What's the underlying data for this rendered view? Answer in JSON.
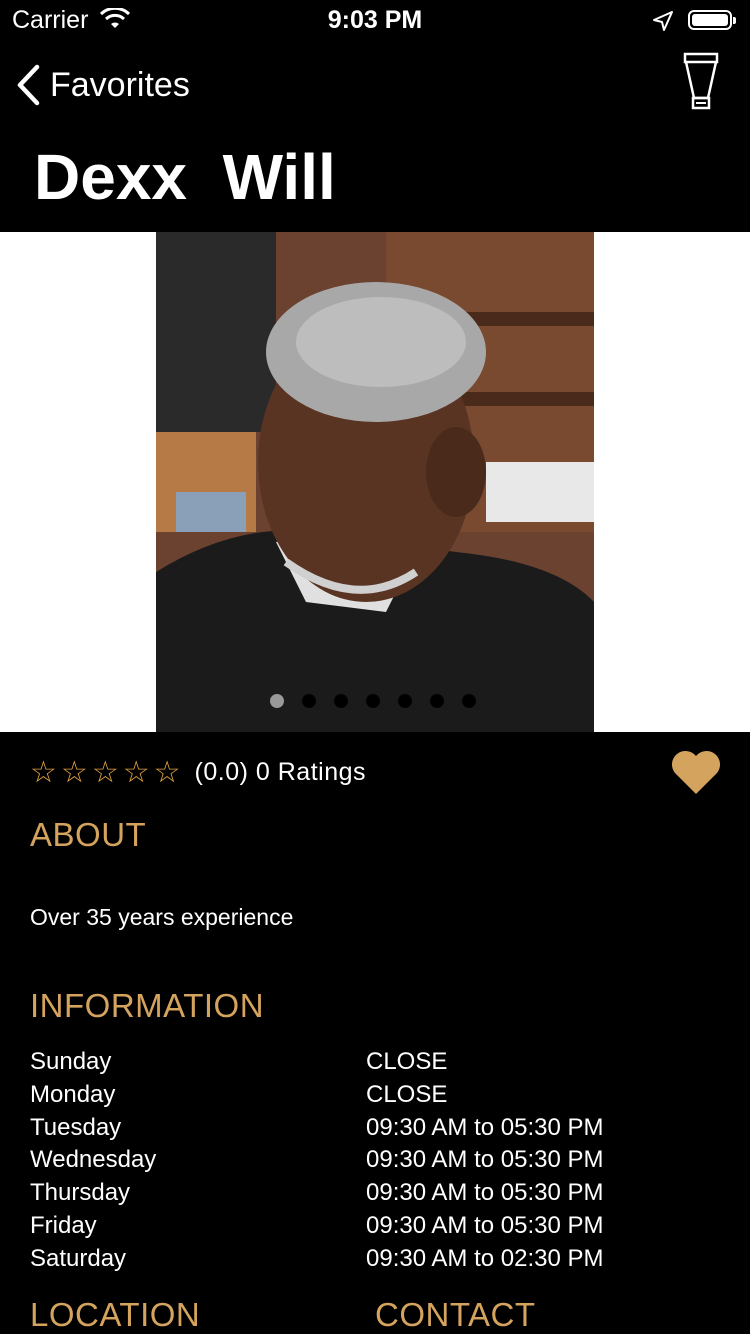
{
  "status_bar": {
    "carrier": "Carrier",
    "time": "9:03 PM"
  },
  "nav": {
    "back_label": "Favorites",
    "cart_icon": "cart-icon"
  },
  "profile": {
    "name": "Dexx  Will"
  },
  "gallery": {
    "photo_count": 7,
    "active_index": 0
  },
  "rating": {
    "stars_filled": 0,
    "stars_total": 5,
    "summary": "(0.0) 0 Ratings"
  },
  "colors": {
    "accent": "#d4a35e",
    "star": "#e0a040",
    "background": "#000000"
  },
  "about": {
    "heading": "ABOUT",
    "text": "Over 35 years experience"
  },
  "information": {
    "heading": "INFORMATION",
    "hours": [
      {
        "day": "Sunday",
        "time": "CLOSE"
      },
      {
        "day": "Monday",
        "time": "CLOSE"
      },
      {
        "day": "Tuesday",
        "time": "09:30 AM to 05:30 PM"
      },
      {
        "day": "Wednesday",
        "time": "09:30 AM to 05:30 PM"
      },
      {
        "day": "Thursday",
        "time": "09:30 AM to 05:30 PM"
      },
      {
        "day": "Friday",
        "time": "09:30 AM to 05:30 PM"
      },
      {
        "day": "Saturday",
        "time": "09:30 AM to 02:30 PM"
      }
    ]
  },
  "location": {
    "heading": "LOCATION"
  },
  "contact": {
    "heading": "CONTACT"
  }
}
